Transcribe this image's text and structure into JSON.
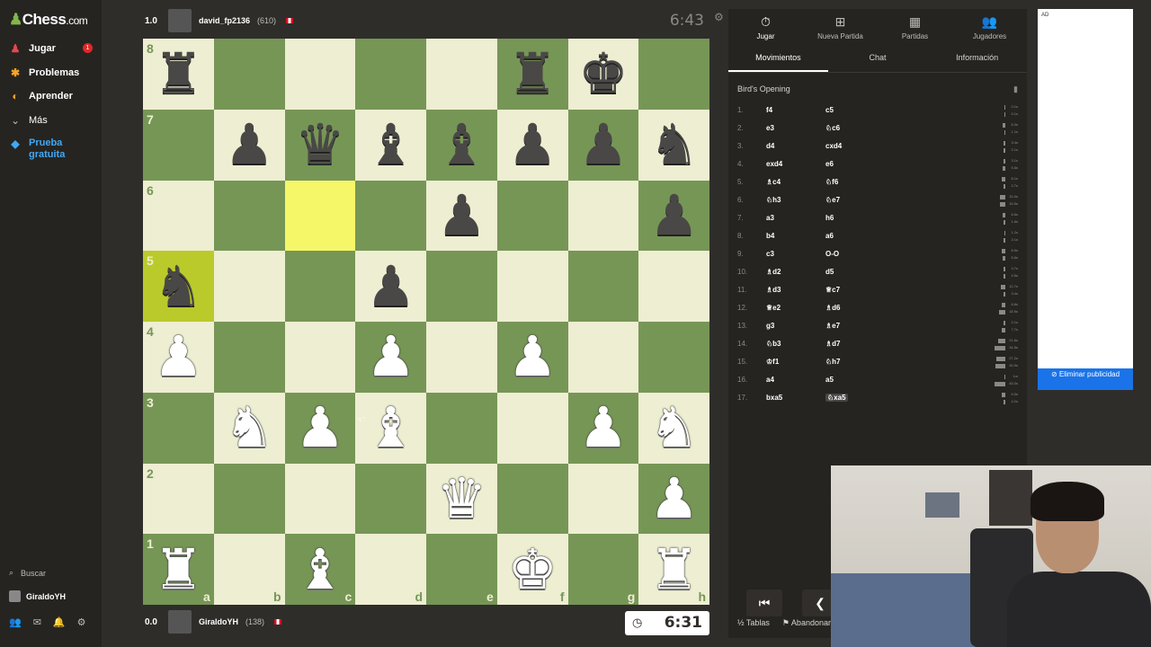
{
  "sidebar": {
    "logo": "Chess",
    "logo_suffix": ".com",
    "items": [
      {
        "label": "Jugar",
        "icon": "play-icon",
        "color": "#e5484d"
      },
      {
        "label": "Problemas",
        "icon": "puzzle-icon",
        "color": "#f5a623"
      },
      {
        "label": "Aprender",
        "icon": "learn-icon",
        "color": "#f5a623"
      },
      {
        "label": "Más",
        "icon": "chevron-down-icon",
        "color": "#bdbcb9"
      },
      {
        "label": "Prueba gratuita",
        "icon": "diamond-icon",
        "color": "#3fa9f5"
      }
    ],
    "play_badge": "1",
    "search": "Buscar",
    "user": "GiraldoYH"
  },
  "top_player": {
    "score": "1.0",
    "name": "david_fp2136",
    "rating": "(610)",
    "clock": "6:43"
  },
  "bottom_player": {
    "score": "0.0",
    "name": "GiraldoYH",
    "rating": "(138)",
    "clock": "6:31"
  },
  "board": {
    "light": "#eeeed2",
    "dark": "#769656",
    "rows": [
      [
        "r",
        "",
        "",
        "",
        "",
        "r",
        "k",
        ""
      ],
      [
        "",
        "p",
        "q",
        "b",
        "b",
        "p",
        "p",
        "n"
      ],
      [
        "",
        "",
        "",
        "",
        "p",
        "",
        "",
        "p"
      ],
      [
        "n",
        "",
        "",
        "p",
        "",
        "",
        "",
        ""
      ],
      [
        "P",
        "",
        "",
        "P",
        "",
        "P",
        "",
        ""
      ],
      [
        "",
        "N",
        "P",
        "B",
        "",
        "",
        "P",
        "N"
      ],
      [
        "",
        "",
        "",
        "",
        "Q",
        "",
        "",
        "P"
      ],
      [
        "R",
        "",
        "B",
        "",
        "",
        "K",
        "",
        "R"
      ]
    ],
    "highlight": [
      "a5",
      "c6"
    ],
    "ranks": [
      "8",
      "7",
      "6",
      "5",
      "4",
      "3",
      "2",
      "1"
    ],
    "files": [
      "a",
      "b",
      "c",
      "d",
      "e",
      "f",
      "g",
      "h"
    ]
  },
  "panel": {
    "tabs": [
      {
        "label": "Jugar",
        "icon": "stopwatch-icon",
        "active": true
      },
      {
        "label": "Nueva Partida",
        "icon": "plus-square-icon",
        "active": false
      },
      {
        "label": "Partidas",
        "icon": "board-icon",
        "active": false
      },
      {
        "label": "Jugadores",
        "icon": "users-icon",
        "active": false
      }
    ],
    "subtabs": [
      "Movimientos",
      "Chat",
      "Información"
    ],
    "opening": "Bird's Opening",
    "moves": [
      {
        "n": "1.",
        "w": "f4",
        "b": "c5",
        "wt": [
          "0.1s",
          "0.1s"
        ]
      },
      {
        "n": "2.",
        "w": "e3",
        "b": "♘c6",
        "wt": [
          "6.3s",
          "1.1s"
        ]
      },
      {
        "n": "3.",
        "w": "d4",
        "b": "cxd4",
        "wt": [
          "3.4s",
          "2.1s"
        ]
      },
      {
        "n": "4.",
        "w": "exd4",
        "b": "e6",
        "wt": [
          "3.1s",
          "5.6s"
        ]
      },
      {
        "n": "5.",
        "w": "♗c4",
        "b": "♘f6",
        "wt": [
          "8.1s",
          "2.7s"
        ]
      },
      {
        "n": "6.",
        "w": "♘h3",
        "b": "♘e7",
        "wt": [
          "15.0s",
          "15.5s"
        ]
      },
      {
        "n": "7.",
        "w": "a3",
        "b": "h6",
        "wt": [
          "6.6s",
          "1.6s"
        ]
      },
      {
        "n": "8.",
        "w": "b4",
        "b": "a6",
        "wt": [
          "1.2s",
          "2.1s"
        ]
      },
      {
        "n": "9.",
        "w": "c3",
        "b": "O-O",
        "wt": [
          "8.9s",
          "5.6s"
        ]
      },
      {
        "n": "10.",
        "w": "♗d2",
        "b": "d5",
        "wt": [
          "3.7s",
          "4.5s"
        ]
      },
      {
        "n": "11.",
        "w": "♗d3",
        "b": "♕c7",
        "wt": [
          "12.7s",
          "3.4s"
        ]
      },
      {
        "n": "12.",
        "w": "♕e2",
        "b": "♗d6",
        "wt": [
          "8.8s",
          "18.9s"
        ]
      },
      {
        "n": "13.",
        "w": "g3",
        "b": "♗e7",
        "wt": [
          "2.1s",
          "7.7s"
        ]
      },
      {
        "n": "14.",
        "w": "♘b3",
        "b": "♗d7",
        "wt": [
          "21.6s",
          "34.5s"
        ]
      },
      {
        "n": "15.",
        "w": "♔f1",
        "b": "♘h7",
        "wt": [
          "27.2s",
          "30.9s"
        ]
      },
      {
        "n": "16.",
        "w": "a4",
        "b": "a5",
        "wt": [
          "1m",
          "45.0s"
        ]
      },
      {
        "n": "17.",
        "w": "bxa5",
        "b": "♘xa5",
        "wt": [
          "9.0s",
          "4.2s"
        ]
      }
    ],
    "footer": [
      "½ Tablas",
      "⚑ Abandonar"
    ]
  },
  "ad": {
    "label": "AD",
    "remove": "Eliminar publicidad"
  }
}
